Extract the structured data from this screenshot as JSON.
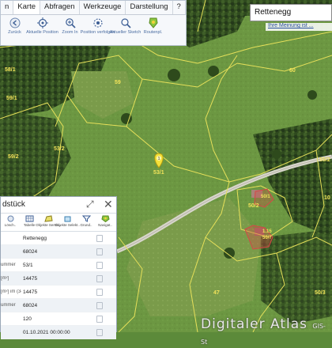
{
  "tabs": [
    "n",
    "Karte",
    "Abfragen",
    "Werkzeuge",
    "Darstellung",
    "?"
  ],
  "tools": [
    {
      "label": "Zurück",
      "icon": "back-icon"
    },
    {
      "label": "Aktuelle Position",
      "icon": "location-icon"
    },
    {
      "label": "Zoom In",
      "icon": "zoom-in-icon"
    },
    {
      "label": "Position verfolgen",
      "icon": "follow-position-icon"
    },
    {
      "label": "Aktueller Sketch",
      "icon": "sketch-icon"
    },
    {
      "label": "Routenpl.",
      "icon": "route-icon"
    }
  ],
  "search": {
    "value": "Rettenegg"
  },
  "feedback_link": "Ihre Meinung ist ...",
  "parcel_labels": [
    {
      "text": "59",
      "color": "#f2e35a"
    },
    {
      "text": "60",
      "color": "#f2e35a"
    },
    {
      "text": "59/1",
      "color": "#f2e35a"
    },
    {
      "text": "58/1",
      "color": "#f2e35a"
    },
    {
      "text": "53/2",
      "color": "#f2e35a"
    },
    {
      "text": "59/2",
      "color": "#f2e35a"
    },
    {
      "text": "53/1",
      "color": "#f2e35a"
    },
    {
      "text": "55/2",
      "color": "#f2e35a"
    },
    {
      "text": "50/2",
      "color": "#f2e35a"
    },
    {
      "text": "50/1",
      "color": "#f2e35a"
    },
    {
      "text": "1.15",
      "color": "#f2e35a"
    },
    {
      "text": "50/7",
      "color": "#f2e35a"
    },
    {
      "text": "47",
      "color": "#f2e35a"
    },
    {
      "text": "50/3",
      "color": "#f2e35a"
    },
    {
      "text": "10",
      "color": "#f2e35a"
    }
  ],
  "marker": {
    "number": "1"
  },
  "panel": {
    "title": "dstück",
    "tools": [
      {
        "label": "Lösch..",
        "icon": "delete-icon"
      },
      {
        "label": "Tabelle",
        "icon": "table-icon"
      },
      {
        "label": "Objekte Servic..",
        "icon": "objects-icon"
      },
      {
        "label": "Objekte Selekt..",
        "icon": "select-icon"
      },
      {
        "label": "Grund..",
        "icon": "filter-icon"
      },
      {
        "label": "Navigat..",
        "icon": "navigate-icon"
      }
    ],
    "rows": [
      {
        "label": "",
        "value": "Rettenegg"
      },
      {
        "label": "",
        "value": "68024"
      },
      {
        "label": "ummer",
        "value": "53/1"
      },
      {
        "label": "[m²]",
        "value": "14475"
      },
      {
        "label": "[m²] im (34",
        "value": "14475"
      },
      {
        "label": "ummer",
        "value": "68024"
      },
      {
        "label": "",
        "value": "120"
      },
      {
        "label": "",
        "value": "01.10.2021 00:00:00"
      }
    ]
  },
  "watermark": {
    "main": "Digitaler Atlas",
    "sub": "GIS-St"
  },
  "colors": {
    "parcel_line": "#e6e05a",
    "panel_border": "#9aa7b7",
    "link": "#2a4fa0",
    "marker": "#f4e13a"
  }
}
